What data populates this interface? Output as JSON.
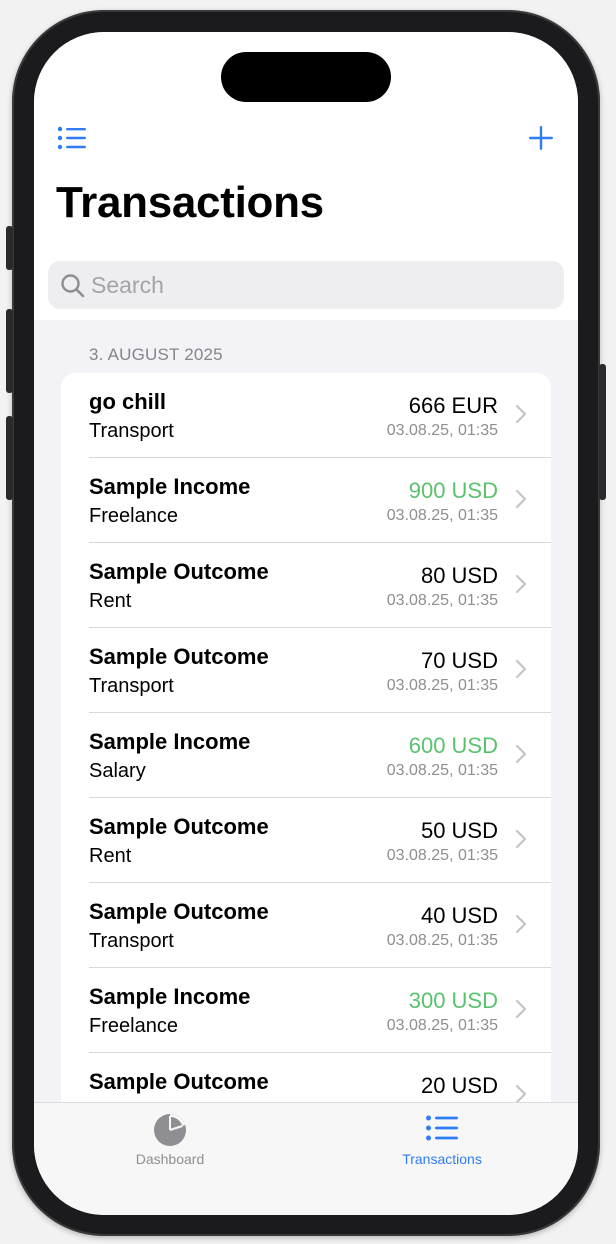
{
  "nav": {
    "left_icon": "list-icon",
    "right_icon": "plus-icon",
    "title": "Transactions"
  },
  "search": {
    "placeholder": "Search"
  },
  "section": {
    "header": "3. AUGUST 2025"
  },
  "transactions": [
    {
      "title": "go chill",
      "category": "Transport",
      "amount": "666 EUR",
      "date": "03.08.25, 01:35",
      "type": "outcome"
    },
    {
      "title": "Sample Income",
      "category": "Freelance",
      "amount": "900 USD",
      "date": "03.08.25, 01:35",
      "type": "income"
    },
    {
      "title": "Sample Outcome",
      "category": "Rent",
      "amount": "80 USD",
      "date": "03.08.25, 01:35",
      "type": "outcome"
    },
    {
      "title": "Sample Outcome",
      "category": "Transport",
      "amount": "70 USD",
      "date": "03.08.25, 01:35",
      "type": "outcome"
    },
    {
      "title": "Sample Income",
      "category": "Salary",
      "amount": "600 USD",
      "date": "03.08.25, 01:35",
      "type": "income"
    },
    {
      "title": "Sample Outcome",
      "category": "Rent",
      "amount": "50 USD",
      "date": "03.08.25, 01:35",
      "type": "outcome"
    },
    {
      "title": "Sample Outcome",
      "category": "Transport",
      "amount": "40 USD",
      "date": "03.08.25, 01:35",
      "type": "outcome"
    },
    {
      "title": "Sample Income",
      "category": "Freelance",
      "amount": "300 USD",
      "date": "03.08.25, 01:35",
      "type": "income"
    },
    {
      "title": "Sample Outcome",
      "category": "",
      "amount": "20 USD",
      "date": "",
      "type": "outcome"
    }
  ],
  "tabbar": {
    "tabs": [
      {
        "label": "Dashboard",
        "icon": "pie-chart-icon",
        "active": false
      },
      {
        "label": "Transactions",
        "icon": "list-icon",
        "active": true
      }
    ]
  },
  "colors": {
    "accent": "#2f7cf6",
    "income": "#5ac16e",
    "secondary_text": "#8e8e93",
    "inactive_tab": "#8e8e93"
  }
}
